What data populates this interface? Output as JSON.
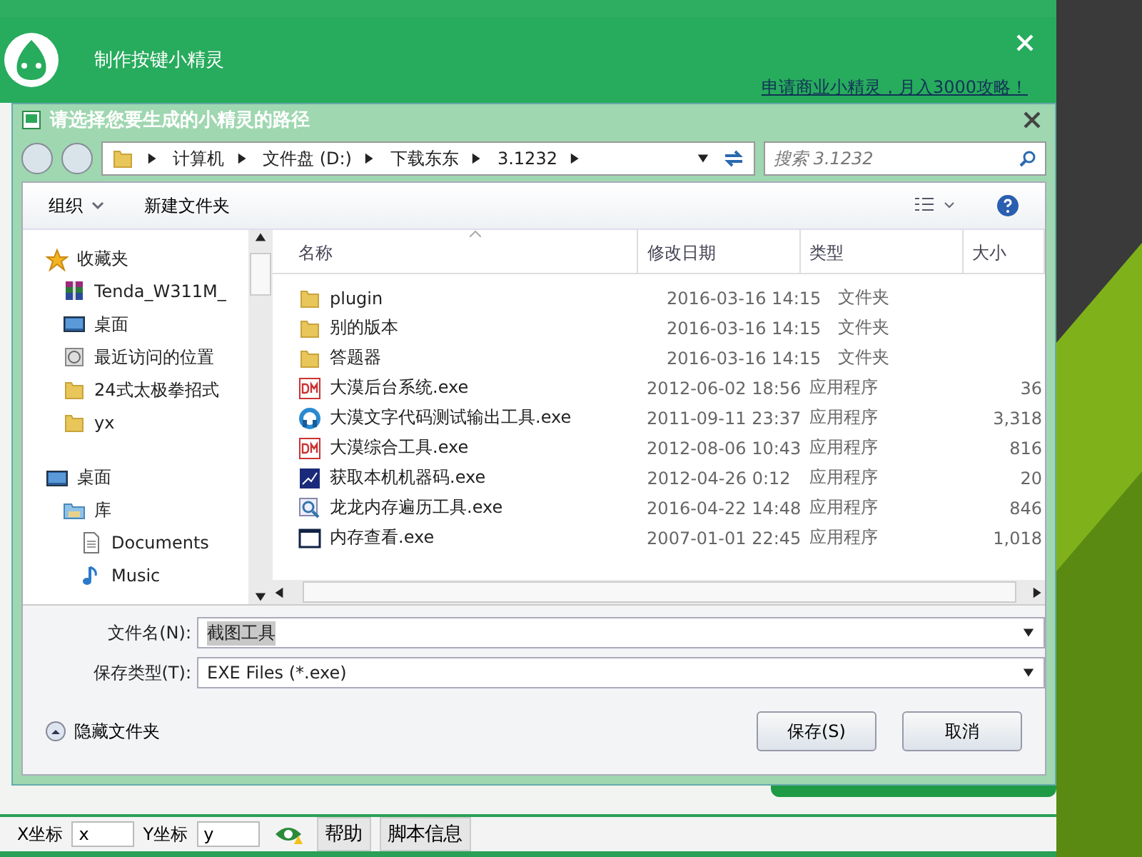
{
  "app": {
    "title": "制作按键小精灵",
    "link": "申请商业小精灵，月入3000攻略！"
  },
  "dialog": {
    "title": "请选择您要生成的小精灵的路径",
    "breadcrumb": [
      "计算机",
      "文件盘 (D:)",
      "下载东东",
      "3.1232"
    ],
    "search": {
      "placeholder": "搜索 3.1232"
    },
    "toolbar": [
      {
        "label": "组织",
        "menu": true
      },
      {
        "label": "新建文件夹",
        "menu": false
      }
    ],
    "nav": [
      {
        "label": "收藏夹",
        "kind": "star",
        "children": [
          {
            "label": "Tenda_W311M_",
            "kind": "archive"
          },
          {
            "label": "桌面",
            "kind": "desktop"
          },
          {
            "label": "最近访问的位置",
            "kind": "recent"
          },
          {
            "label": "24式太极拳招式",
            "kind": "folder"
          },
          {
            "label": "yx",
            "kind": "folder"
          }
        ]
      },
      {
        "label": "桌面",
        "kind": "desktop",
        "children": [
          {
            "label": "库",
            "kind": "library",
            "children": [
              {
                "label": "Documents",
                "kind": "document"
              },
              {
                "label": "Music",
                "kind": "music"
              }
            ]
          }
        ]
      }
    ],
    "columns": [
      "名称",
      "修改日期",
      "类型",
      "大小"
    ],
    "files": [
      {
        "name": "plugin",
        "date": "2016-03-16 14:15",
        "type": "文件夹",
        "kind": "folder"
      },
      {
        "name": "别的版本",
        "date": "2016-03-16 14:15",
        "type": "文件夹",
        "kind": "folder"
      },
      {
        "name": "答题器",
        "date": "2016-03-16 14:15",
        "type": "文件夹",
        "kind": "folder"
      },
      {
        "name": "大漠后台系统.exe",
        "date": "2012-06-02 18:56",
        "type": "应用程序",
        "size": "36",
        "kind": "dm"
      },
      {
        "name": "大漠文字代码测试输出工具.exe",
        "date": "2011-09-11 23:37",
        "type": "应用程序",
        "size": "3,318",
        "kind": "ring"
      },
      {
        "name": "大漠综合工具.exe",
        "date": "2012-08-06 10:43",
        "type": "应用程序",
        "size": "816",
        "kind": "dm"
      },
      {
        "name": "获取本机机器码.exe",
        "date": "2012-04-26 0:12",
        "type": "应用程序",
        "size": "20",
        "kind": "chip"
      },
      {
        "name": "龙龙内存遍历工具.exe",
        "date": "2016-04-22 14:48",
        "type": "应用程序",
        "size": "846",
        "kind": "magnifier"
      },
      {
        "name": "内存查看.exe",
        "date": "2007-01-01 22:45",
        "type": "应用程序",
        "size": "1,018",
        "kind": "window"
      }
    ],
    "filename": {
      "label": "文件名(N):",
      "value": "截图工具"
    },
    "filetype": {
      "label": "保存类型(T):",
      "value": "EXE Files (*.exe)"
    },
    "hide_folders": "隐藏文件夹",
    "buttons": [
      "保存(S)",
      "取消"
    ]
  },
  "statusbar": {
    "x_label": "X坐标",
    "x_value": "x",
    "y_label": "Y坐标",
    "y_value": "y",
    "buttons": [
      "帮助",
      "脚本信息"
    ]
  }
}
